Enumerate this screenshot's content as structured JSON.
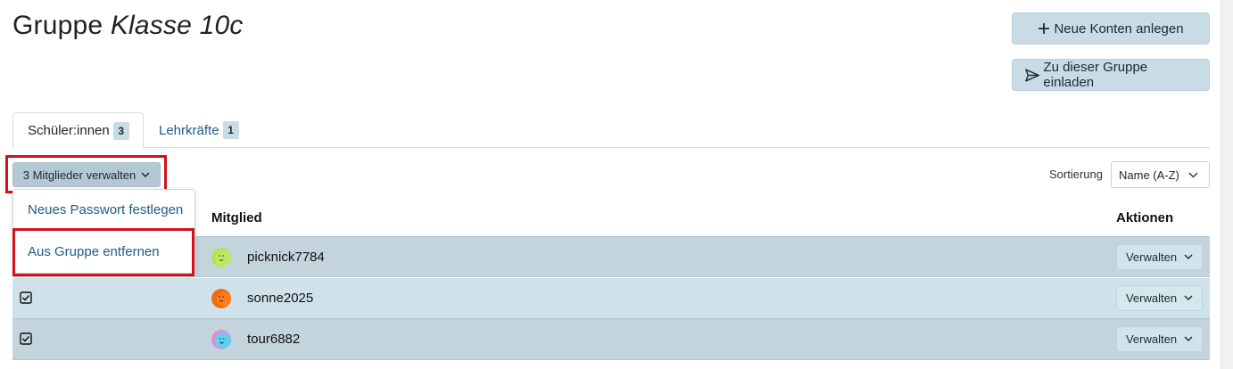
{
  "header": {
    "title_prefix": "Gruppe",
    "group_name": "Klasse 10c"
  },
  "actions": {
    "new_accounts": "Neue Konten anlegen",
    "invite": "Zu dieser Gruppe einladen"
  },
  "tabs": [
    {
      "label": "Schüler:innen",
      "count": "3",
      "active": true
    },
    {
      "label": "Lehrkräfte",
      "count": "1",
      "active": false
    }
  ],
  "bulk": {
    "label": "3 Mitglieder verwalten",
    "menu": [
      {
        "label": "Neues Passwort festlegen"
      },
      {
        "label": "Aus Gruppe entfernen"
      }
    ]
  },
  "sort": {
    "label": "Sortierung",
    "selected": "Name (A-Z)"
  },
  "table": {
    "columns": {
      "member": "Mitglied",
      "actions": "Aktionen"
    },
    "rows": [
      {
        "username": "picknick7784",
        "checked": true,
        "manage": "Verwalten",
        "avatar_color": "#b6e05a"
      },
      {
        "username": "sonne2025",
        "checked": true,
        "manage": "Verwalten",
        "avatar_color": "#f46b0e"
      },
      {
        "username": "tour6882",
        "checked": true,
        "manage": "Verwalten",
        "avatar_color": "#5fd0ee"
      }
    ]
  },
  "colors": {
    "highlight": "#d4111b",
    "link": "#1c5d84",
    "button_bg": "#c9dce6"
  }
}
